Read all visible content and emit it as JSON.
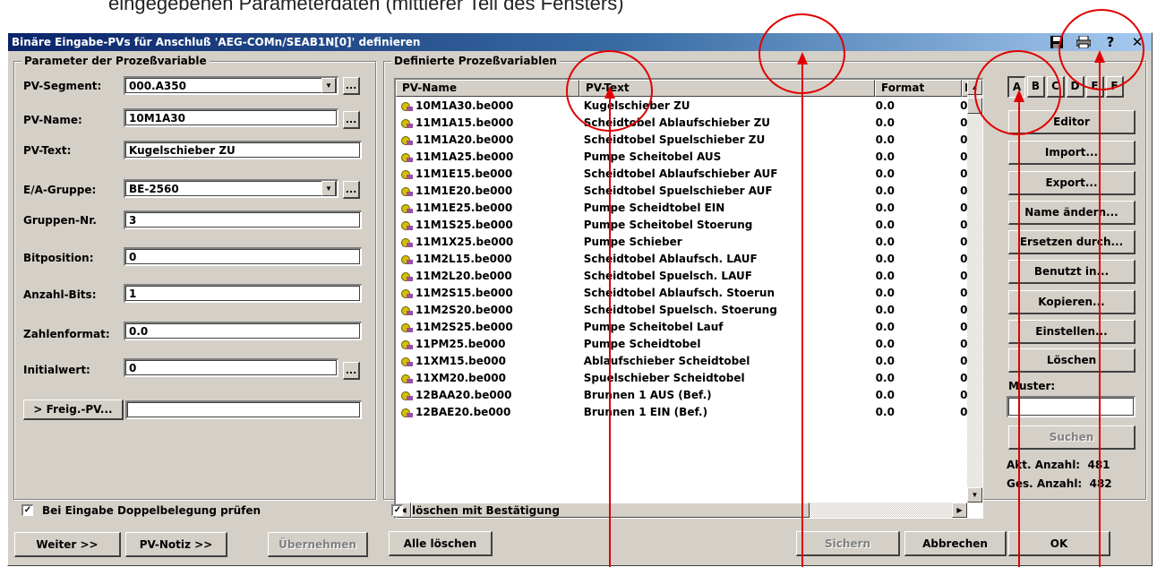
{
  "caption": "eingegebenen Parameterdaten (mittlerer Teil des Fensters)",
  "window": {
    "title": "Binäre Eingabe-PVs für Anschluß 'AEG-COMn/SEAB1N[0]' definieren",
    "icons": [
      "save-icon",
      "print-icon",
      "help-icon",
      "close-icon"
    ],
    "icon_glyphs": [
      "💾",
      "🖶",
      "?",
      "✕"
    ]
  },
  "params": {
    "group_title": "Parameter der Prozeßvariable",
    "pv_segment_label": "PV-Segment:",
    "pv_segment_value": "000.A350",
    "pv_name_label": "PV-Name:",
    "pv_name_value": "10M1A30",
    "pv_text_label": "PV-Text:",
    "pv_text_value": "Kugelschieber ZU",
    "ea_gruppe_label": "E/A-Gruppe:",
    "ea_gruppe_value": "BE-2560",
    "gruppen_nr_label": "Gruppen-Nr.",
    "gruppen_nr_value": "3",
    "bitposition_label": "Bitposition:",
    "bitposition_value": "0",
    "anzahl_bits_label": "Anzahl-Bits:",
    "anzahl_bits_value": "1",
    "zahlenformat_label": "Zahlenformat:",
    "zahlenformat_value": "0.0",
    "initialwert_label": "Initialwert:",
    "initialwert_value": "0",
    "freig_pv_button": "> Freig.-PV...",
    "freig_pv_value": "",
    "ellipsis": "...",
    "doppelbelegung_label": "Bei Eingabe Doppelbelegung prüfen",
    "weiter_button": "Weiter >>",
    "pv_notiz_button": "PV-Notiz >>",
    "uebernehmen_button": "Übernehmen"
  },
  "list": {
    "group_title": "Definierte Prozeßvariablen",
    "columns": [
      "PV-Name",
      "PV-Text",
      "Format",
      "I"
    ],
    "rows": [
      {
        "name": "10M1A30.be000",
        "text": "Kugelschieber ZU",
        "format": "0.0",
        "i": "0"
      },
      {
        "name": "11M1A15.be000",
        "text": "Scheidtobel Ablaufschieber ZU",
        "format": "0.0",
        "i": "0"
      },
      {
        "name": "11M1A20.be000",
        "text": "Scheidtobel Spuelschieber ZU",
        "format": "0.0",
        "i": "0"
      },
      {
        "name": "11M1A25.be000",
        "text": "Pumpe Scheitobel AUS",
        "format": "0.0",
        "i": "0"
      },
      {
        "name": "11M1E15.be000",
        "text": "Scheidtobel Ablaufschieber AUF",
        "format": "0.0",
        "i": "0"
      },
      {
        "name": "11M1E20.be000",
        "text": "Scheidtobel Spuelschieber AUF",
        "format": "0.0",
        "i": "0"
      },
      {
        "name": "11M1E25.be000",
        "text": "Pumpe Scheidtobel EIN",
        "format": "0.0",
        "i": "0"
      },
      {
        "name": "11M1S25.be000",
        "text": "Pumpe Scheitobel Stoerung",
        "format": "0.0",
        "i": "0"
      },
      {
        "name": "11M1X25.be000",
        "text": "Pumpe Schieber",
        "format": "0.0",
        "i": "0"
      },
      {
        "name": "11M2L15.be000",
        "text": "Scheidtobel Ablaufsch. LAUF",
        "format": "0.0",
        "i": "0"
      },
      {
        "name": "11M2L20.be000",
        "text": "Scheidtobel Spuelsch. LAUF",
        "format": "0.0",
        "i": "0"
      },
      {
        "name": "11M2S15.be000",
        "text": "Scheidtobel Ablaufsch. Stoerun",
        "format": "0.0",
        "i": "0"
      },
      {
        "name": "11M2S20.be000",
        "text": "Scheidtobel Spuelsch. Stoerung",
        "format": "0.0",
        "i": "0"
      },
      {
        "name": "11M2S25.be000",
        "text": "Pumpe Scheitobel Lauf",
        "format": "0.0",
        "i": "0"
      },
      {
        "name": "11PM25.be000",
        "text": "Pumpe Scheidtobel",
        "format": "0.0",
        "i": "0"
      },
      {
        "name": "11XM15.be000",
        "text": "Ablaufschieber Scheidtobel",
        "format": "0.0",
        "i": "0"
      },
      {
        "name": "11XM20.be000",
        "text": "Spuelschieber Scheidtobel",
        "format": "0.0",
        "i": "0"
      },
      {
        "name": "12BAA20.be000",
        "text": "Brunnen 1 AUS (Bef.)",
        "format": "0.0",
        "i": "0"
      },
      {
        "name": "12BAE20.be000",
        "text": "Brunnen 1 EIN (Bef.)",
        "format": "0.0",
        "i": "0"
      }
    ],
    "loeschen_bestaetigung_label": "löschen mit Bestätigung",
    "alle_loeschen_button": "Alle löschen",
    "sichern_button": "Sichern",
    "abbrechen_button": "Abbrechen"
  },
  "side": {
    "letters": [
      "A",
      "B",
      "C",
      "D",
      "E",
      "F"
    ],
    "active_letter": "A",
    "editor_button": "Editor",
    "import_button": "Import...",
    "export_button": "Export...",
    "name_aendern_button": "Name ändern...",
    "ersetzen_button": "Ersetzen durch...",
    "benutzt_button": "Benutzt in...",
    "kopieren_button": "Kopieren...",
    "einstellen_button": "Einstellen...",
    "loeschen_button": "Löschen",
    "muster_label": "Muster:",
    "muster_value": "",
    "suchen_button": "Suchen",
    "akt_anzahl": "Akt. Anzahl:  481",
    "ges_anzahl": "Ges. Anzahl:  482",
    "ok_button": "OK"
  },
  "annotation_color": "#e00000"
}
